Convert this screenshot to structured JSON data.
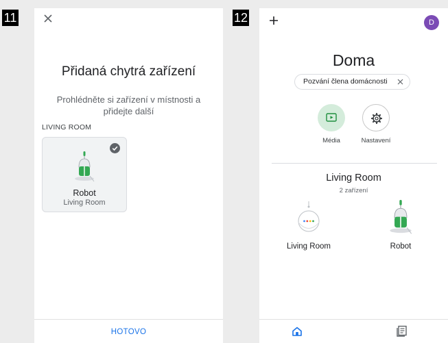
{
  "steps": {
    "left": "11",
    "right": "12"
  },
  "left_screen": {
    "title": "Přidaná chytrá zařízení",
    "subtitle": "Prohlédněte si zařízení v místnosti a přidejte další",
    "room_label": "LIVING ROOM",
    "device": {
      "name": "Robot",
      "room": "Living Room",
      "selected": true
    },
    "done_label": "HOTOVO",
    "icons": [
      "close-icon",
      "check-icon",
      "robot-icon"
    ]
  },
  "right_screen": {
    "avatar_letter": "D",
    "home_title": "Doma",
    "invite_chip": "Pozvání člena domácnosti",
    "actions": [
      {
        "label": "Média",
        "icon": "media-icon"
      },
      {
        "label": "Nastavení",
        "icon": "gear-icon"
      }
    ],
    "room": {
      "name": "Living Room",
      "count": "2 zařízení"
    },
    "devices": [
      {
        "name": "Living Room",
        "icon": "smart-speaker-icon"
      },
      {
        "name": "Robot",
        "icon": "robot-icon"
      }
    ],
    "bottom_nav": [
      "home-icon",
      "feed-icon"
    ]
  },
  "colors": {
    "accent_blue": "#1a73e8",
    "avatar_purple": "#7b4bb5",
    "media_green": "#d4ecdb",
    "robot_green": "#34a853"
  }
}
